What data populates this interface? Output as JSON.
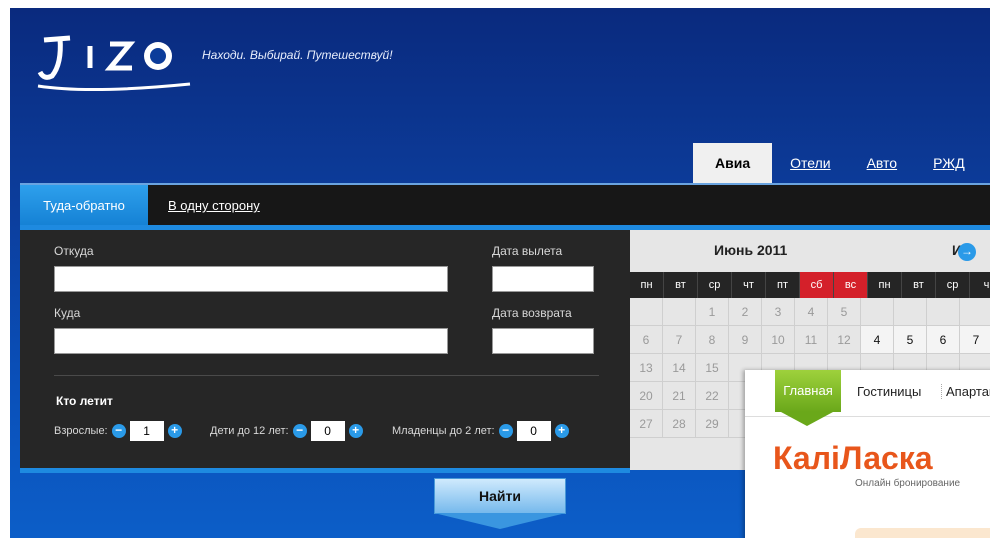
{
  "brand": {
    "logo_text": "Jiz",
    "tagline": "Находи. Выбирай. Путешествуй!"
  },
  "modes": [
    {
      "label": "Авиа",
      "active": true
    },
    {
      "label": "Отели",
      "active": false
    },
    {
      "label": "Авто",
      "active": false
    },
    {
      "label": "РЖД",
      "active": false
    }
  ],
  "trip_type": {
    "round": "Туда-обратно",
    "oneway": "В одну сторону"
  },
  "form": {
    "from_label": "Откуда",
    "to_label": "Куда",
    "depart_label": "Дата вылета",
    "return_label": "Дата возврата",
    "who_label": "Кто летит",
    "adults_label": "Взрослые:",
    "adults_value": "1",
    "children_label": "Дети до 12 лет:",
    "children_value": "0",
    "infants_label": "Младенцы до 2 лет:",
    "infants_value": "0",
    "search_label": "Найти"
  },
  "calendar": {
    "title": "Июнь 2011",
    "next_title": "И",
    "dow": [
      "пн",
      "вт",
      "ср",
      "чт",
      "пт",
      "сб",
      "вс",
      "пн",
      "вт",
      "ср",
      "ч"
    ],
    "rows": [
      [
        "",
        "",
        "1",
        "2",
        "3",
        "4",
        "5",
        "",
        "",
        "",
        ""
      ],
      [
        "6",
        "7",
        "8",
        "9",
        "10",
        "11",
        "12",
        "4",
        "5",
        "6",
        "7"
      ],
      [
        "13",
        "14",
        "15",
        "",
        "",
        "",
        "",
        "",
        "",
        "",
        ""
      ],
      [
        "20",
        "21",
        "22",
        "",
        "",
        "",
        "",
        "",
        "",
        "",
        ""
      ],
      [
        "27",
        "28",
        "29",
        "",
        "",
        "",
        "",
        "",
        "",
        "",
        ""
      ]
    ]
  },
  "popup": {
    "tabs": [
      "Главная",
      "Гостиницы",
      "Апартам"
    ],
    "logo": "КаліЛаска",
    "subtitle": "Онлайн бронирование"
  }
}
